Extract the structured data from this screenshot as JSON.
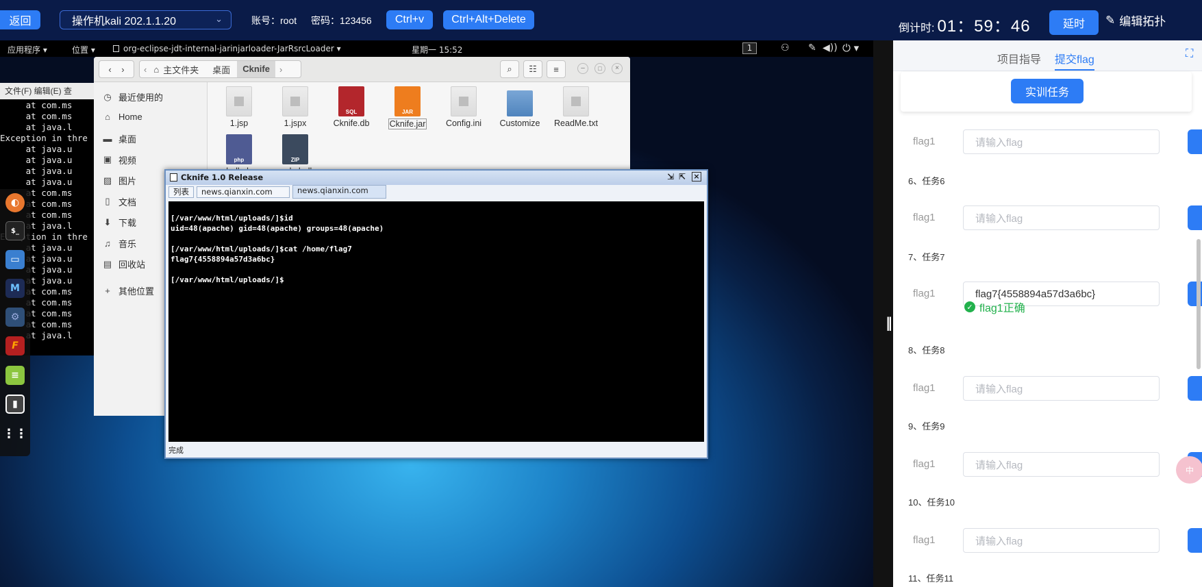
{
  "topbar": {
    "back": "返回",
    "machine": "操作机kali 202.1.1.20",
    "account": "账号：root",
    "password": "密码：123456",
    "paste": "Ctrl+v",
    "cad": "Ctrl+Alt+Delete",
    "countdown_label": "倒计时:",
    "countdown_time": "01：59：46",
    "extend": "延时",
    "edit_topology": "编辑拓扑"
  },
  "gnome_bar": {
    "applications": "应用程序 ▾",
    "places": "位置 ▾",
    "active_app": "org-eclipse-jdt-internal-jarinjarloader-JarRsrcLoader ▾",
    "clock": "星期一 15:52",
    "workspace": "1"
  },
  "bg_terminal": {
    "menu": "文件(F)  编辑(E)  查",
    "lines": [
      "     at com.ms",
      "     at com.ms",
      "     at java.l",
      "Exception in thre",
      "     at java.u",
      "     at java.u",
      "     at java.u",
      "     at java.u",
      "     at com.ms",
      "     at com.ms",
      "     at com.ms",
      "     at java.l",
      "Exception in thre",
      "     at java.u",
      "     at java.u",
      "     at java.u",
      "     at java.u",
      "     at com.ms",
      "     at com.ms",
      "     at com.ms",
      "     at com.ms",
      "     at java.l"
    ]
  },
  "file_manager": {
    "breadcrumb_home": "主文件夹",
    "breadcrumb_desktop": "桌面",
    "breadcrumb_current": "Cknife",
    "sidebar": [
      {
        "icon": "clock-icon",
        "glyph": "◷",
        "label": "最近使用的"
      },
      {
        "icon": "home-icon",
        "glyph": "⌂",
        "label": "Home"
      },
      {
        "icon": "desktop-icon",
        "glyph": "▬",
        "label": "桌面"
      },
      {
        "icon": "video-icon",
        "glyph": "▣",
        "label": "视频"
      },
      {
        "icon": "picture-icon",
        "glyph": "▨",
        "label": "图片"
      },
      {
        "icon": "document-icon",
        "glyph": "▯",
        "label": "文档"
      },
      {
        "icon": "download-icon",
        "glyph": "⬇",
        "label": "下载"
      },
      {
        "icon": "music-icon",
        "glyph": "♫",
        "label": "音乐"
      },
      {
        "icon": "trash-icon",
        "glyph": "▤",
        "label": "回收站"
      },
      {
        "icon": "plus-icon",
        "glyph": "+",
        "label": "其他位置"
      }
    ],
    "files": [
      {
        "name": "1.jsp",
        "kind": "doc"
      },
      {
        "name": "1.jspx",
        "kind": "doc"
      },
      {
        "name": "Cknife.db",
        "kind": "sql"
      },
      {
        "name": "Cknife.jar",
        "kind": "jar"
      },
      {
        "name": "Config.ini",
        "kind": "doc"
      },
      {
        "name": "Customize",
        "kind": "folder"
      },
      {
        "name": "ReadMe.txt",
        "kind": "doc"
      },
      {
        "name": "shell.php",
        "kind": "php"
      },
      {
        "name": "webshell",
        "kind": "zip"
      }
    ],
    "sql_badge": "SQL",
    "jar_badge": "JAR",
    "php_badge": "php",
    "zip_badge": "ZIP"
  },
  "cknife": {
    "title": "Cknife 1.0 Release",
    "tabs": [
      "列表",
      "news.qianxin.com",
      "news.qianxin.com"
    ],
    "terminal_lines": [
      "[/var/www/html/uploads/]$id",
      "uid=48(apache) gid=48(apache) groups=48(apache)",
      "",
      "[/var/www/html/uploads/]$cat /home/flag7",
      "flag7{4558894a57d3a6bc}",
      "",
      "[/var/www/html/uploads/]$"
    ],
    "status": "完成"
  },
  "panel": {
    "tab_guide": "项目指导",
    "tab_submit": "提交flag",
    "task_button": "实训任务",
    "tasks": [
      {
        "title": "",
        "label": "flag1",
        "value": "",
        "placeholder": "请输入flag"
      },
      {
        "title": "6、任务6",
        "label": "flag1",
        "value": "",
        "placeholder": "请输入flag"
      },
      {
        "title": "7、任务7",
        "label": "flag1",
        "value": "flag7{4558894a57d3a6bc}",
        "placeholder": "请输入flag"
      },
      {
        "title": "8、任务8",
        "label": "flag1",
        "value": "",
        "placeholder": "请输入flag"
      },
      {
        "title": "9、任务9",
        "label": "flag1",
        "value": "",
        "placeholder": "请输入flag"
      },
      {
        "title": "10、任务10",
        "label": "flag1",
        "value": "",
        "placeholder": "请输入flag"
      },
      {
        "title": "11、任务11",
        "label": "",
        "value": "",
        "placeholder": ""
      }
    ],
    "flag_correct": "flag1正确"
  },
  "colors": {
    "accent": "#2d7cf5",
    "success": "#22b14c",
    "topbar": "#0a1b48"
  }
}
